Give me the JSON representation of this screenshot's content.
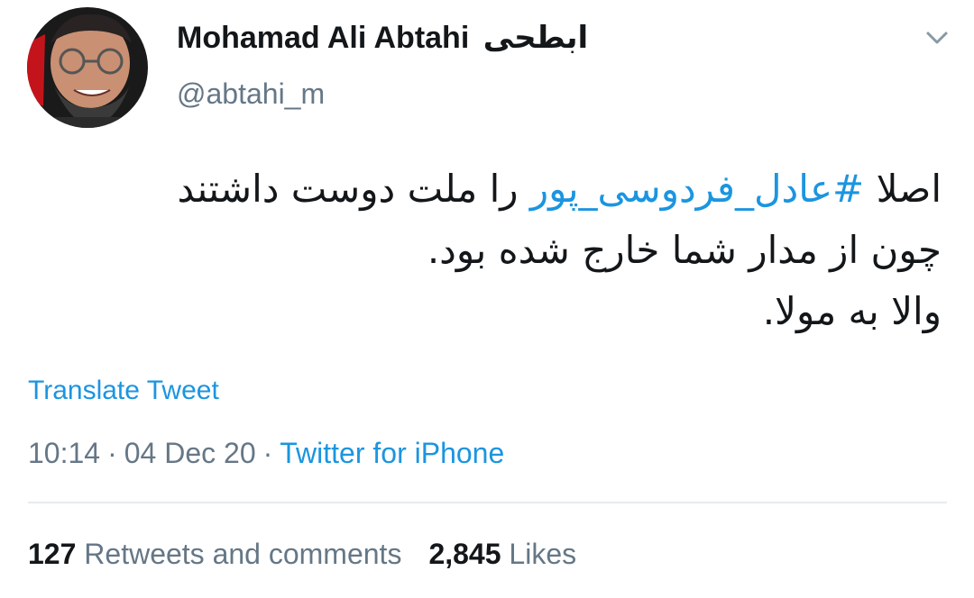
{
  "tweet": {
    "author": {
      "name": "Mohamad Ali Abtahi",
      "name_fa": "ابطحی",
      "handle": "@abtahi_m",
      "avatar_icon": "user-avatar-photo"
    },
    "menu_icon": "chevron-down-icon",
    "text": {
      "line1_start": "اصلا ",
      "hashtag": "#عادل_فردوسی_پور",
      "line1_end": " را ملت دوست داشتند",
      "line2": "چون از مدار شما خارج شده بود.",
      "line3": "والا به مولا."
    },
    "translate_label": "Translate Tweet",
    "time": "10:14",
    "date": "04 Dec 20",
    "separator": "·",
    "source": "Twitter for iPhone",
    "stats": {
      "retweets_count": "127",
      "retweets_label": "Retweets and comments",
      "likes_count": "2,845",
      "likes_label": "Likes"
    },
    "colors": {
      "link": "#1b95e0",
      "secondary_text": "#657786",
      "primary_text": "#14171a",
      "divider": "#e6ecf0"
    }
  }
}
